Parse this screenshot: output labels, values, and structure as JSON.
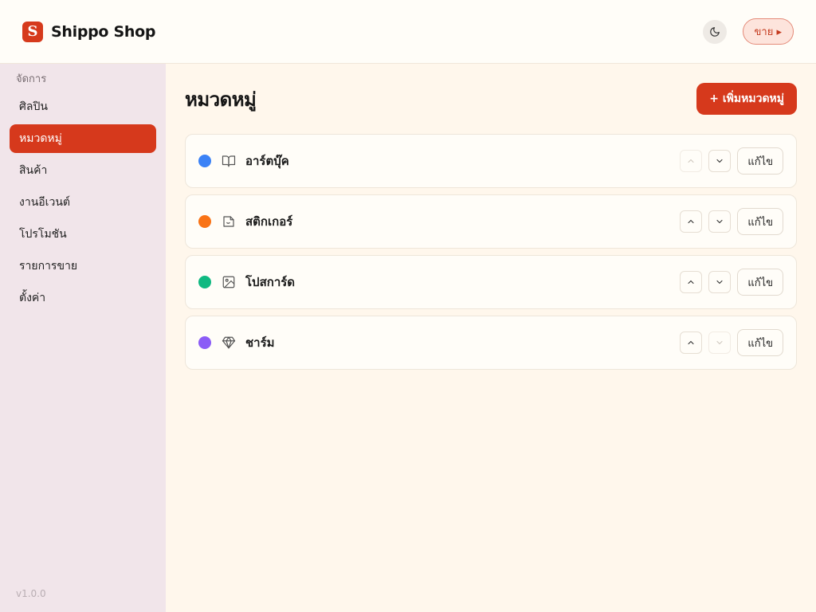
{
  "header": {
    "logo_letter": "S",
    "brand": "Shippo Shop",
    "sell_label": "ขาย ▸"
  },
  "sidebar": {
    "section_label": "จัดการ",
    "items": [
      {
        "label": "ศิลปิน",
        "active": false
      },
      {
        "label": "หมวดหมู่",
        "active": true
      },
      {
        "label": "สินค้า",
        "active": false
      },
      {
        "label": "งานอีเวนต์",
        "active": false
      },
      {
        "label": "โปรโมชัน",
        "active": false
      },
      {
        "label": "รายการขาย",
        "active": false
      },
      {
        "label": "ตั้งค่า",
        "active": false
      }
    ],
    "version": "v1.0.0"
  },
  "main": {
    "title": "หมวดหมู่",
    "add_label": "+ เพิ่มหมวดหมู่",
    "categories": [
      {
        "name": "อาร์ตบุ๊ค",
        "color": "#3b82f6",
        "icon": "book-icon",
        "up_disabled": true,
        "down_disabled": false,
        "edit_label": "แก้ไข"
      },
      {
        "name": "สติกเกอร์",
        "color": "#f97316",
        "icon": "sticker-icon",
        "up_disabled": false,
        "down_disabled": false,
        "edit_label": "แก้ไข"
      },
      {
        "name": "โปสการ์ด",
        "color": "#10b981",
        "icon": "image-icon",
        "up_disabled": false,
        "down_disabled": false,
        "edit_label": "แก้ไข"
      },
      {
        "name": "ชาร์ม",
        "color": "#8b5cf6",
        "icon": "gem-icon",
        "up_disabled": false,
        "down_disabled": true,
        "edit_label": "แก้ไข"
      }
    ]
  }
}
